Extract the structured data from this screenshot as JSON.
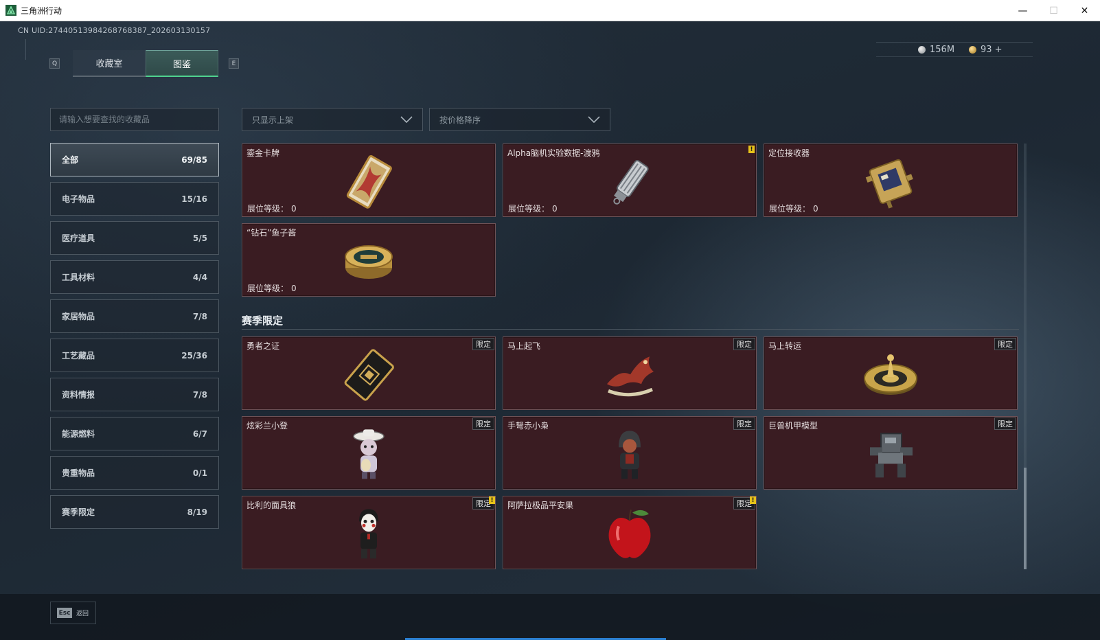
{
  "window": {
    "title": "三角洲行动",
    "minimize": "—",
    "maximize": "☐",
    "close": "✕"
  },
  "header": {
    "uid": "CN UID:274405139842687​68387_202603130157",
    "key_left": "Q",
    "key_right": "E",
    "tabs": [
      {
        "label": "收藏室",
        "active": false
      },
      {
        "label": "图鉴",
        "active": true
      }
    ],
    "currency": {
      "silver": "156M",
      "gold": "93 +"
    }
  },
  "search": {
    "placeholder": "请输入想要查找的收藏品"
  },
  "categories": [
    {
      "label": "全部",
      "count": "69/85",
      "active": true
    },
    {
      "label": "电子物品",
      "count": "15/16"
    },
    {
      "label": "医疗道具",
      "count": "5/5"
    },
    {
      "label": "工具材料",
      "count": "4/4"
    },
    {
      "label": "家居物品",
      "count": "7/8"
    },
    {
      "label": "工艺藏品",
      "count": "25/36"
    },
    {
      "label": "资料情报",
      "count": "7/8"
    },
    {
      "label": "能源燃料",
      "count": "6/7"
    },
    {
      "label": "贵重物品",
      "count": "0/1"
    },
    {
      "label": "赛季限定",
      "count": "8/19"
    }
  ],
  "filters": {
    "show": "只显示上架",
    "sort": "按价格降序"
  },
  "level_label": "展位等级：",
  "limited_label": "限定",
  "warn_glyph": "!",
  "top_items": [
    {
      "name": "鎏金卡牌",
      "level": "0",
      "icon": "gold-card-icon",
      "warn": false
    },
    {
      "name": "Alpha脑机实验数据-渡鸦",
      "level": "0",
      "icon": "data-canister-icon",
      "warn": true
    },
    {
      "name": "定位接收器",
      "level": "0",
      "icon": "locator-receiver-icon",
      "warn": false
    },
    {
      "name": "“钻石”鱼子酱",
      "level": "0",
      "icon": "caviar-tin-icon",
      "warn": false
    }
  ],
  "season_section": {
    "title": "赛季限定",
    "items": [
      {
        "name": "勇者之证",
        "icon": "brave-card-icon",
        "warn": false
      },
      {
        "name": "马上起飞",
        "icon": "rocking-horse-icon",
        "warn": false
      },
      {
        "name": "马上转运",
        "icon": "fortune-wheel-icon",
        "warn": false
      },
      {
        "name": "炫彩兰小登",
        "icon": "sombrero-figure-icon",
        "warn": false
      },
      {
        "name": "手弩赤小枭",
        "icon": "hooded-figure-icon",
        "warn": false
      },
      {
        "name": "巨兽机甲模型",
        "icon": "mech-model-icon",
        "warn": false
      },
      {
        "name": "比利的面具狼",
        "icon": "puppet-figure-icon",
        "warn": true
      },
      {
        "name": "阿萨拉极品平安果",
        "icon": "apple-icon",
        "warn": true
      }
    ]
  },
  "footer": {
    "esc_key": "Esc",
    "esc_label": "返回"
  },
  "colors": {
    "card_bg": "#3a1c22",
    "active_tab_accent": "#4fd38f",
    "warn": "#e6c21a"
  }
}
